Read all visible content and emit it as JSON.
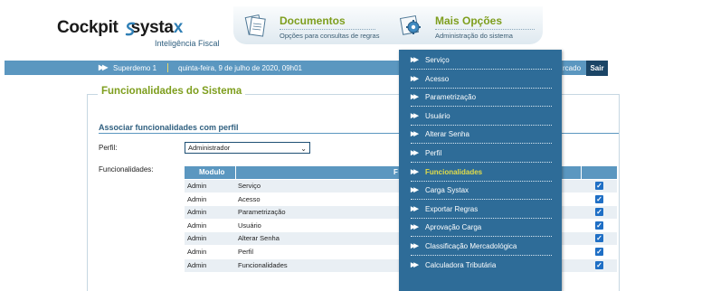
{
  "header": {
    "logo_left": "Cockpit",
    "logo_right_main": "systa",
    "logo_right_x": "x",
    "logo_subtitle": "Inteligência Fiscal",
    "tabs": [
      {
        "title": "Documentos",
        "subtitle": "Opções para consultas de regras",
        "icon": "documents-icon"
      },
      {
        "title": "Mais Opções",
        "subtitle": "Administração do sistema",
        "icon": "gear-icon"
      }
    ]
  },
  "topbar": {
    "double_arrow": "▶▶",
    "user": "Superdemo 1",
    "date": "quinta-feira, 9 de julho de 2020, 09h01",
    "right_text": "rcado",
    "logout": "Sair"
  },
  "page": {
    "title": "Funcionalidades do Sistema",
    "section_title": "Associar funcionalidades com perfil",
    "profile_label": "Perfil:",
    "profile_value": "Administrador",
    "features_label": "Funcionalidades:"
  },
  "table": {
    "headers": [
      "Modulo",
      "F"
    ],
    "rows": [
      {
        "modulo": "Admin",
        "funcionalidade": "Serviço",
        "checked": true
      },
      {
        "modulo": "Admin",
        "funcionalidade": "Acesso",
        "checked": true
      },
      {
        "modulo": "Admin",
        "funcionalidade": "Parametrização",
        "checked": true
      },
      {
        "modulo": "Admin",
        "funcionalidade": "Usuário",
        "checked": true
      },
      {
        "modulo": "Admin",
        "funcionalidade": "Alterar Senha",
        "checked": true
      },
      {
        "modulo": "Admin",
        "funcionalidade": "Perfil",
        "checked": true
      },
      {
        "modulo": "Admin",
        "funcionalidade": "Funcionalidades",
        "checked": true
      }
    ]
  },
  "menu": {
    "arrow": "▶▶",
    "active_index": 6,
    "items": [
      "Serviço",
      "Acesso",
      "Parametrização",
      "Usuário",
      "Alterar Senha",
      "Perfil",
      "Funcionalidades",
      "Carga Systax",
      "Exportar Regras",
      "Aprovação Carga",
      "Classificação Mercadológica",
      "Calculadora Tributária"
    ]
  },
  "colors": {
    "brand_blue": "#5b97c0",
    "menu_bg": "#2e6c98",
    "accent_green": "#7e9e1d",
    "menu_active": "#e2dd4a",
    "checkbox": "#1f6fc5"
  }
}
